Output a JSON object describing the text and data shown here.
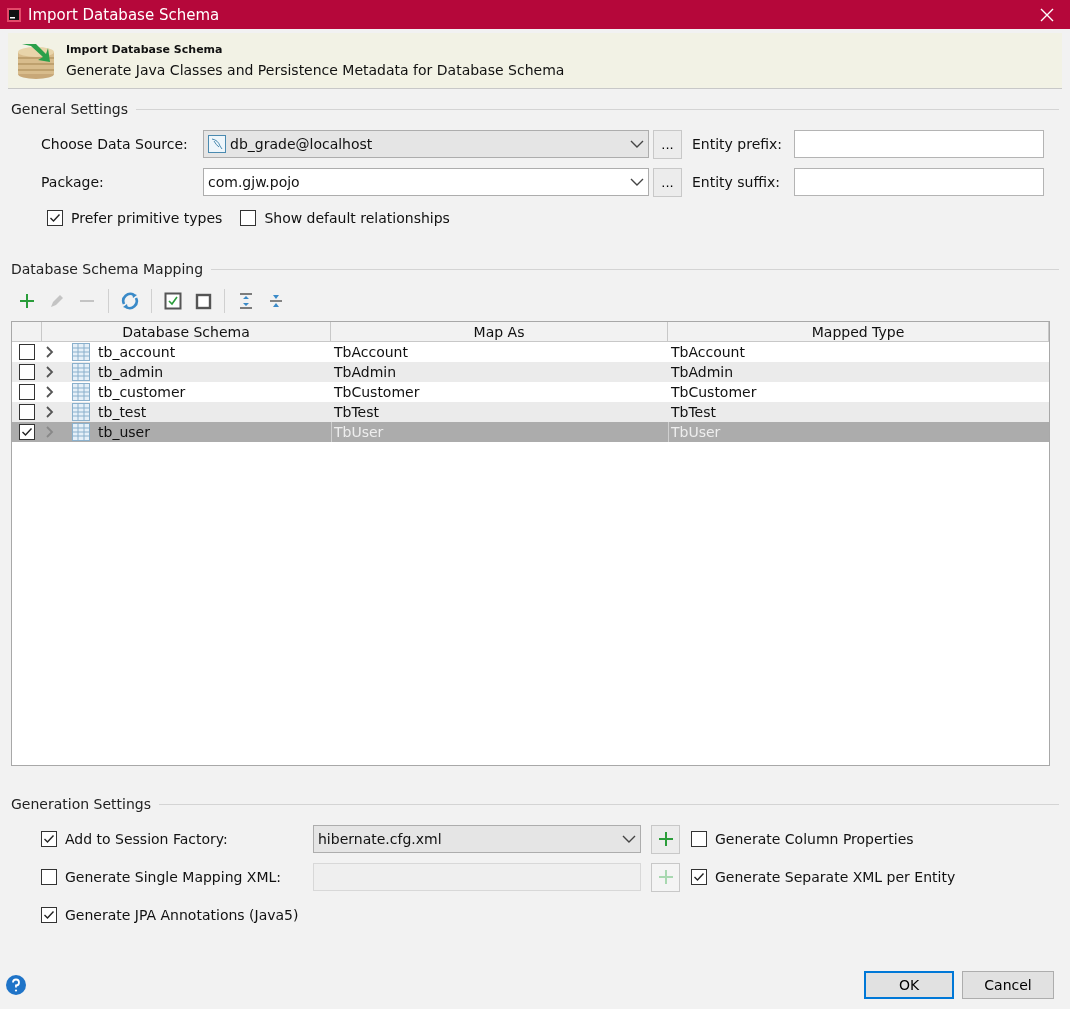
{
  "window": {
    "title": "Import Database Schema"
  },
  "banner": {
    "title": "Import Database Schema",
    "subtitle": "Generate Java Classes and Persistence Metadata for Database Schema"
  },
  "general_settings": {
    "heading": "General Settings",
    "data_source": {
      "label": "Choose Data Source:",
      "value": "db_grade@localhost",
      "browse": "..."
    },
    "package": {
      "label": "Package:",
      "value": "com.gjw.pojo",
      "browse": "..."
    },
    "entity_prefix": {
      "label": "Entity prefix:"
    },
    "entity_suffix": {
      "label": "Entity suffix:"
    },
    "options": [
      {
        "label": "Prefer primitive types",
        "checked": true
      },
      {
        "label": "Show default relationships",
        "checked": false
      }
    ]
  },
  "schema_mapping": {
    "heading": "Database Schema Mapping",
    "toolbar": [
      {
        "kind": "add",
        "disabled": false
      },
      {
        "kind": "edit",
        "disabled": true
      },
      {
        "kind": "remove",
        "disabled": true
      },
      {
        "kind": "refresh",
        "disabled": false
      },
      {
        "kind": "check-all",
        "disabled": false
      },
      {
        "kind": "uncheck-all",
        "disabled": false
      },
      {
        "kind": "expand",
        "disabled": false
      },
      {
        "kind": "collapse",
        "disabled": false
      }
    ],
    "columns": [
      "Database Schema",
      "Map As",
      "Mapped Type"
    ],
    "rows": [
      {
        "name": "tb_account",
        "map_as": "TbAccount",
        "mapped_type": "TbAccount",
        "checked": false,
        "selected": false
      },
      {
        "name": "tb_admin",
        "map_as": "TbAdmin",
        "mapped_type": "TbAdmin",
        "checked": false,
        "selected": false
      },
      {
        "name": "tb_customer",
        "map_as": "TbCustomer",
        "mapped_type": "TbCustomer",
        "checked": false,
        "selected": false
      },
      {
        "name": "tb_test",
        "map_as": "TbTest",
        "mapped_type": "TbTest",
        "checked": false,
        "selected": false
      },
      {
        "name": "tb_user",
        "map_as": "TbUser",
        "mapped_type": "TbUser",
        "checked": true,
        "selected": true
      }
    ]
  },
  "generation_settings": {
    "heading": "Generation Settings",
    "rows": [
      {
        "label": "Add to Session Factory:",
        "checked": true,
        "field": {
          "kind": "combo",
          "value": "hibernate.cfg.xml",
          "disabled": false
        },
        "add_disabled": false,
        "right": {
          "label": "Generate Column Properties",
          "checked": false
        }
      },
      {
        "label": "Generate Single Mapping XML:",
        "checked": false,
        "field": {
          "kind": "text",
          "disabled": true
        },
        "add_disabled": true,
        "right": {
          "label": "Generate Separate XML per Entity",
          "checked": true
        }
      },
      {
        "label": "Generate JPA Annotations (Java5)",
        "checked": true
      }
    ]
  },
  "buttons": [
    {
      "label": "OK",
      "default": true
    },
    {
      "label": "Cancel",
      "default": false
    }
  ]
}
